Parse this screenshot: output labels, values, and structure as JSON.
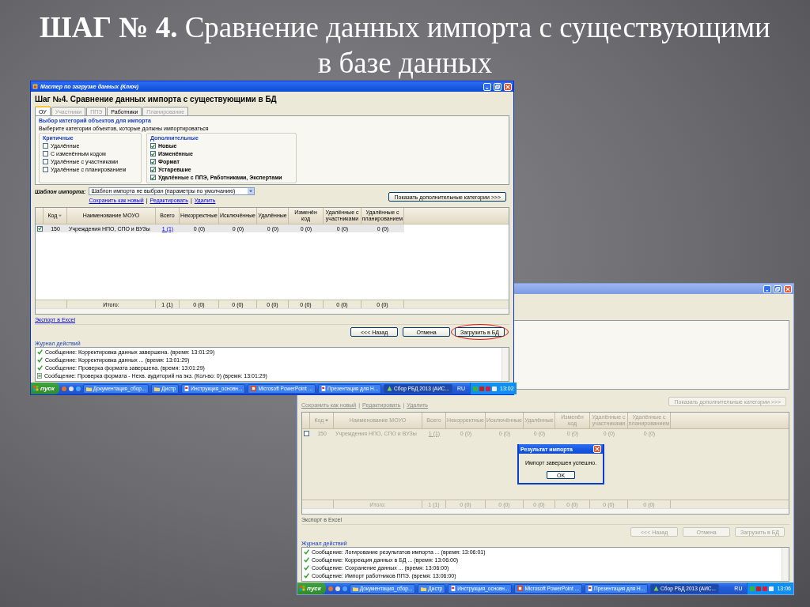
{
  "slide": {
    "title": "**ШАГ № 4.** Сравнение данных импорта с существующими в базе данных"
  },
  "windows": [
    {
      "active": true,
      "title": "Мастер по загрузке данных (Ключ)",
      "heading": "Шаг №4.  Сравнение данных импорта с существующими в БД",
      "tabs": [
        {
          "label": "ОУ",
          "selected": true,
          "disabled": false
        },
        {
          "label": "Участники",
          "selected": false,
          "disabled": true
        },
        {
          "label": "ППЭ",
          "selected": false,
          "disabled": true
        },
        {
          "label": "Работники",
          "selected": false,
          "disabled": false
        },
        {
          "label": "Планирование",
          "selected": false,
          "disabled": true
        }
      ],
      "group": {
        "title": "Выбор категорий объектов для импорта",
        "hint": "Выберите категории объектов, которые должны импортироваться",
        "subgroups": [
          {
            "title": "Критичные",
            "items": [
              {
                "label": "Удалённые",
                "checked": false
              },
              {
                "label": "С изменённым кодом",
                "checked": false
              },
              {
                "label": "Удалённые с участниками",
                "checked": false
              },
              {
                "label": "Удалённые с планированием",
                "checked": false
              }
            ]
          },
          {
            "title": "Дополнительные",
            "items": [
              {
                "label": "Новые",
                "checked": true
              },
              {
                "label": "Изменённые",
                "checked": true
              },
              {
                "label": "Формат",
                "checked": true
              },
              {
                "label": "Устаревшие",
                "checked": true
              },
              {
                "label": "Удалённые с ППЭ, Работниками, Экспертами",
                "checked": true
              }
            ]
          }
        ]
      },
      "template": {
        "label": "Шаблон импорта:",
        "value": "Шаблон импорта не выбран (параметры по умолчанию)"
      },
      "links": [
        "Сохранить как новый",
        "Редактировать",
        "Удалить"
      ],
      "link_separator": "|",
      "more_button": "Показать дополнительные категории >>>",
      "columns": [
        "Код",
        "Наименование МОУО",
        "Всего",
        "Некорректные",
        "Исключённые",
        "Удалённые",
        "Изменён код",
        "Удалённые с участниками",
        "Удалённые с планированием"
      ],
      "rows": [
        {
          "checked": true,
          "cells": [
            "150",
            "Учреждения НПО, СПО и ВУЗы",
            "1 (1)",
            "0 (0)",
            "0 (0)",
            "0 (0)",
            "0 (0)",
            "0 (0)",
            "0 (0)"
          ]
        }
      ],
      "totals": {
        "label": "Итого:",
        "values": [
          "1 (1)",
          "0 (0)",
          "0 (0)",
          "0 (0)",
          "0 (0)",
          "0 (0)",
          "0 (0)"
        ]
      },
      "export_link": "Экспорт в Excel",
      "buttons": [
        {
          "label": "<<< Назад",
          "highlighted": false
        },
        {
          "label": "Отмена",
          "highlighted": false
        },
        {
          "label": "Загрузить в БД",
          "highlighted": true
        }
      ],
      "log": {
        "title": "Журнал действий",
        "entries": [
          {
            "kind": "ok",
            "text": "Сообщение: Корректировка данных завершена. (время: 13:01:29)"
          },
          {
            "kind": "ok",
            "text": "Сообщение: Корректировка данных ... (время: 13:01:29)"
          },
          {
            "kind": "ok",
            "text": "Сообщение: Проверка формата завершена. (время: 13:01:29)"
          },
          {
            "kind": "info",
            "text": "Сообщение: Проверка формата - Нехв. аудиторий на экз. (Кол-во: 0) (время: 13:01:29)"
          }
        ]
      },
      "taskbar": {
        "start": "пуск",
        "items": [
          {
            "kind": "folder",
            "label": "Документация_сбор...",
            "selected": false
          },
          {
            "kind": "folder",
            "label": "Дистр",
            "selected": false
          },
          {
            "kind": "document",
            "label": "Инструкция_основн...",
            "selected": false
          },
          {
            "kind": "slides",
            "label": "Microsoft PowerPoint ...",
            "selected": false
          },
          {
            "kind": "document",
            "label": "Презентация для Н...",
            "selected": false
          },
          {
            "kind": "app",
            "label": "Сбор РБД 2013 (АИС...",
            "selected": true
          }
        ],
        "lang": "RU",
        "clock": "13:02"
      }
    },
    {
      "active": false,
      "links": [
        "Сохранить как новый",
        "Редактировать",
        "Удалить"
      ],
      "link_separator": "|",
      "more_button": "Показать дополнительные категории >>>",
      "columns": [
        "Код",
        "Наименование МОУО",
        "Всего",
        "Некорректные",
        "Исключённые",
        "Удалённые",
        "Изменён код",
        "Удалённые с участниками",
        "Удалённые с планированием"
      ],
      "rows": [
        {
          "checked": false,
          "cells": [
            "150",
            "Учреждения НПО, СПО и ВУЗы",
            "1 (1)",
            "0 (0)",
            "0 (0)",
            "0 (0)",
            "0 (0)",
            "0 (0)",
            "0 (0)"
          ]
        }
      ],
      "totals": {
        "label": "Итого:",
        "values": [
          "1 (1)",
          "0 (0)",
          "0 (0)",
          "0 (0)",
          "0 (0)",
          "0 (0)",
          "0 (0)"
        ]
      },
      "dialog": {
        "title": "Результат импорта",
        "message": "Импорт завершен успешно.",
        "button": "OK"
      },
      "export_link": "Экспорт в Excel",
      "buttons": [
        {
          "label": "<<< Назад",
          "highlighted": false
        },
        {
          "label": "Отмена",
          "highlighted": false
        },
        {
          "label": "Загрузить в БД",
          "highlighted": false
        }
      ],
      "log": {
        "title": "Журнал действий",
        "entries": [
          {
            "kind": "ok",
            "text": "Сообщение: Логирование результатов импорта ... (время: 13:06:01)"
          },
          {
            "kind": "ok",
            "text": "Сообщение: Коррекция данных в БД ... (время: 13:06:00)"
          },
          {
            "kind": "ok",
            "text": "Сообщение: Сохранение данных ... (время: 13:06:00)"
          },
          {
            "kind": "ok",
            "text": "Сообщение: Импорт работников ППЭ. (время: 13:06:00)"
          }
        ]
      },
      "taskbar": {
        "start": "пуск",
        "items": [
          {
            "kind": "folder",
            "label": "Документация_сбор...",
            "selected": false
          },
          {
            "kind": "folder",
            "label": "Дистр",
            "selected": false
          },
          {
            "kind": "document",
            "label": "Инструкция_основн...",
            "selected": false
          },
          {
            "kind": "slides",
            "label": "Microsoft PowerPoint ...",
            "selected": false
          },
          {
            "kind": "document",
            "label": "Презентация для Н...",
            "selected": false
          },
          {
            "kind": "app",
            "label": "Сбор РБД 2013 (АИС...",
            "selected": true
          }
        ],
        "lang": "RU",
        "clock": "13:06"
      }
    }
  ]
}
